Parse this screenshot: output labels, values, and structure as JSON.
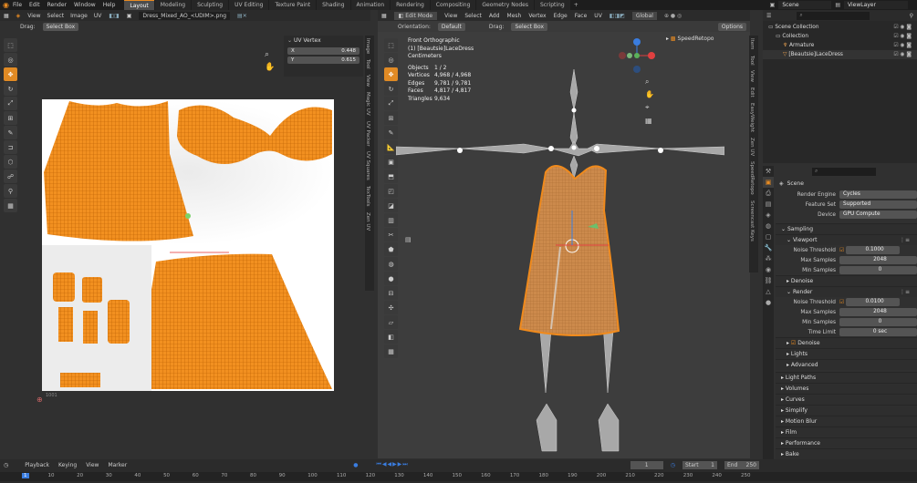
{
  "topbar": {
    "menus": [
      "File",
      "Edit",
      "Render",
      "Window",
      "Help"
    ],
    "workspaces": [
      "Layout",
      "Modeling",
      "Sculpting",
      "UV Editing",
      "Texture Paint",
      "Shading",
      "Animation",
      "Rendering",
      "Compositing",
      "Geometry Nodes",
      "Scripting"
    ],
    "active_workspace": "Layout",
    "scene_name": "Scene",
    "viewlayer_name": "ViewLayer"
  },
  "uv_editor": {
    "menus": [
      "View",
      "Select",
      "Image",
      "UV"
    ],
    "image_name": "Dress_Mixed_AO_<UDIM>.png",
    "drag_label": "Drag:",
    "drag_value": "Select Box",
    "panel_title": "UV Vertex",
    "x_label": "X",
    "x_value": "0.448",
    "y_label": "Y",
    "y_value": "0.615",
    "tile_label": "1001",
    "side_tabs": [
      "Image",
      "Tool",
      "View",
      "Magic UV",
      "UV Packer",
      "UV Squares",
      "TexTools",
      "Zen UV"
    ]
  },
  "viewport": {
    "mode": "Edit Mode",
    "menus": [
      "View",
      "Select",
      "Add",
      "Mesh",
      "Vertex",
      "Edge",
      "Face",
      "UV"
    ],
    "transform": "Global",
    "orientation_label": "Orientation:",
    "orientation_value": "Default",
    "drag_label": "Drag:",
    "drag_value": "Select Box",
    "options_label": "Options",
    "view_name": "Front Orthographic",
    "object_name": "(1) [Beautsie]LaceDress",
    "units": "Centimeters",
    "stats": [
      {
        "label": "Objects",
        "value": "1 / 2"
      },
      {
        "label": "Vertices",
        "value": "4,968 / 4,968"
      },
      {
        "label": "Edges",
        "value": "9,781 / 9,781"
      },
      {
        "label": "Faces",
        "value": "4,817 / 4,817"
      },
      {
        "label": "Triangles",
        "value": "9,634"
      }
    ],
    "speedretopo": "SpeedRetopo",
    "axes": [
      "X",
      "Y",
      "Z"
    ],
    "side_tabs": [
      "Item",
      "Tool",
      "View",
      "Edit",
      "EasyWeight",
      "Zen UV",
      "SpeedRetopo",
      "Screencast Keys"
    ]
  },
  "outliner": {
    "items": [
      {
        "label": "Scene Collection",
        "indent": 0
      },
      {
        "label": "Collection",
        "indent": 1
      },
      {
        "label": "Armature",
        "indent": 2
      },
      {
        "label": "[Beautsie]LaceDress",
        "indent": 2
      }
    ]
  },
  "properties": {
    "header": "Scene",
    "render_engine_label": "Render Engine",
    "render_engine": "Cycles",
    "feature_set_label": "Feature Set",
    "feature_set": "Supported",
    "device_label": "Device",
    "device": "GPU Compute",
    "sampling": "Sampling",
    "viewport": "Viewport",
    "vp_noise_label": "Noise Threshold",
    "vp_noise": "0.1000",
    "vp_max_label": "Max Samples",
    "vp_max": "2048",
    "vp_min_label": "Min Samples",
    "vp_min": "0",
    "denoise": "Denoise",
    "render": "Render",
    "r_noise_label": "Noise Threshold",
    "r_noise": "0.0100",
    "r_max_label": "Max Samples",
    "r_max": "2048",
    "r_min_label": "Min Samples",
    "r_min": "0",
    "r_time_label": "Time Limit",
    "r_time": "0 sec",
    "r_denoise": "Denoise",
    "lights": "Lights",
    "advanced": "Advanced",
    "sections": [
      "Light Paths",
      "Volumes",
      "Curves",
      "Simplify",
      "Motion Blur",
      "Film",
      "Performance",
      "Bake"
    ]
  },
  "timeline": {
    "menus": [
      "Playback",
      "Keying",
      "View",
      "Marker"
    ],
    "current_frame": "1",
    "start_label": "Start",
    "start": "1",
    "end_label": "End",
    "end": "250",
    "ruler": [
      "1",
      "10",
      "20",
      "30",
      "40",
      "50",
      "60",
      "70",
      "80",
      "90",
      "100",
      "110",
      "120",
      "130",
      "140",
      "150",
      "160",
      "170",
      "180",
      "190",
      "200",
      "210",
      "220",
      "230",
      "240",
      "250"
    ]
  },
  "colors": {
    "accent": "#e88b22",
    "mesh": "#f08a1c",
    "panel": "#303030",
    "header": "#2b2b2b"
  }
}
